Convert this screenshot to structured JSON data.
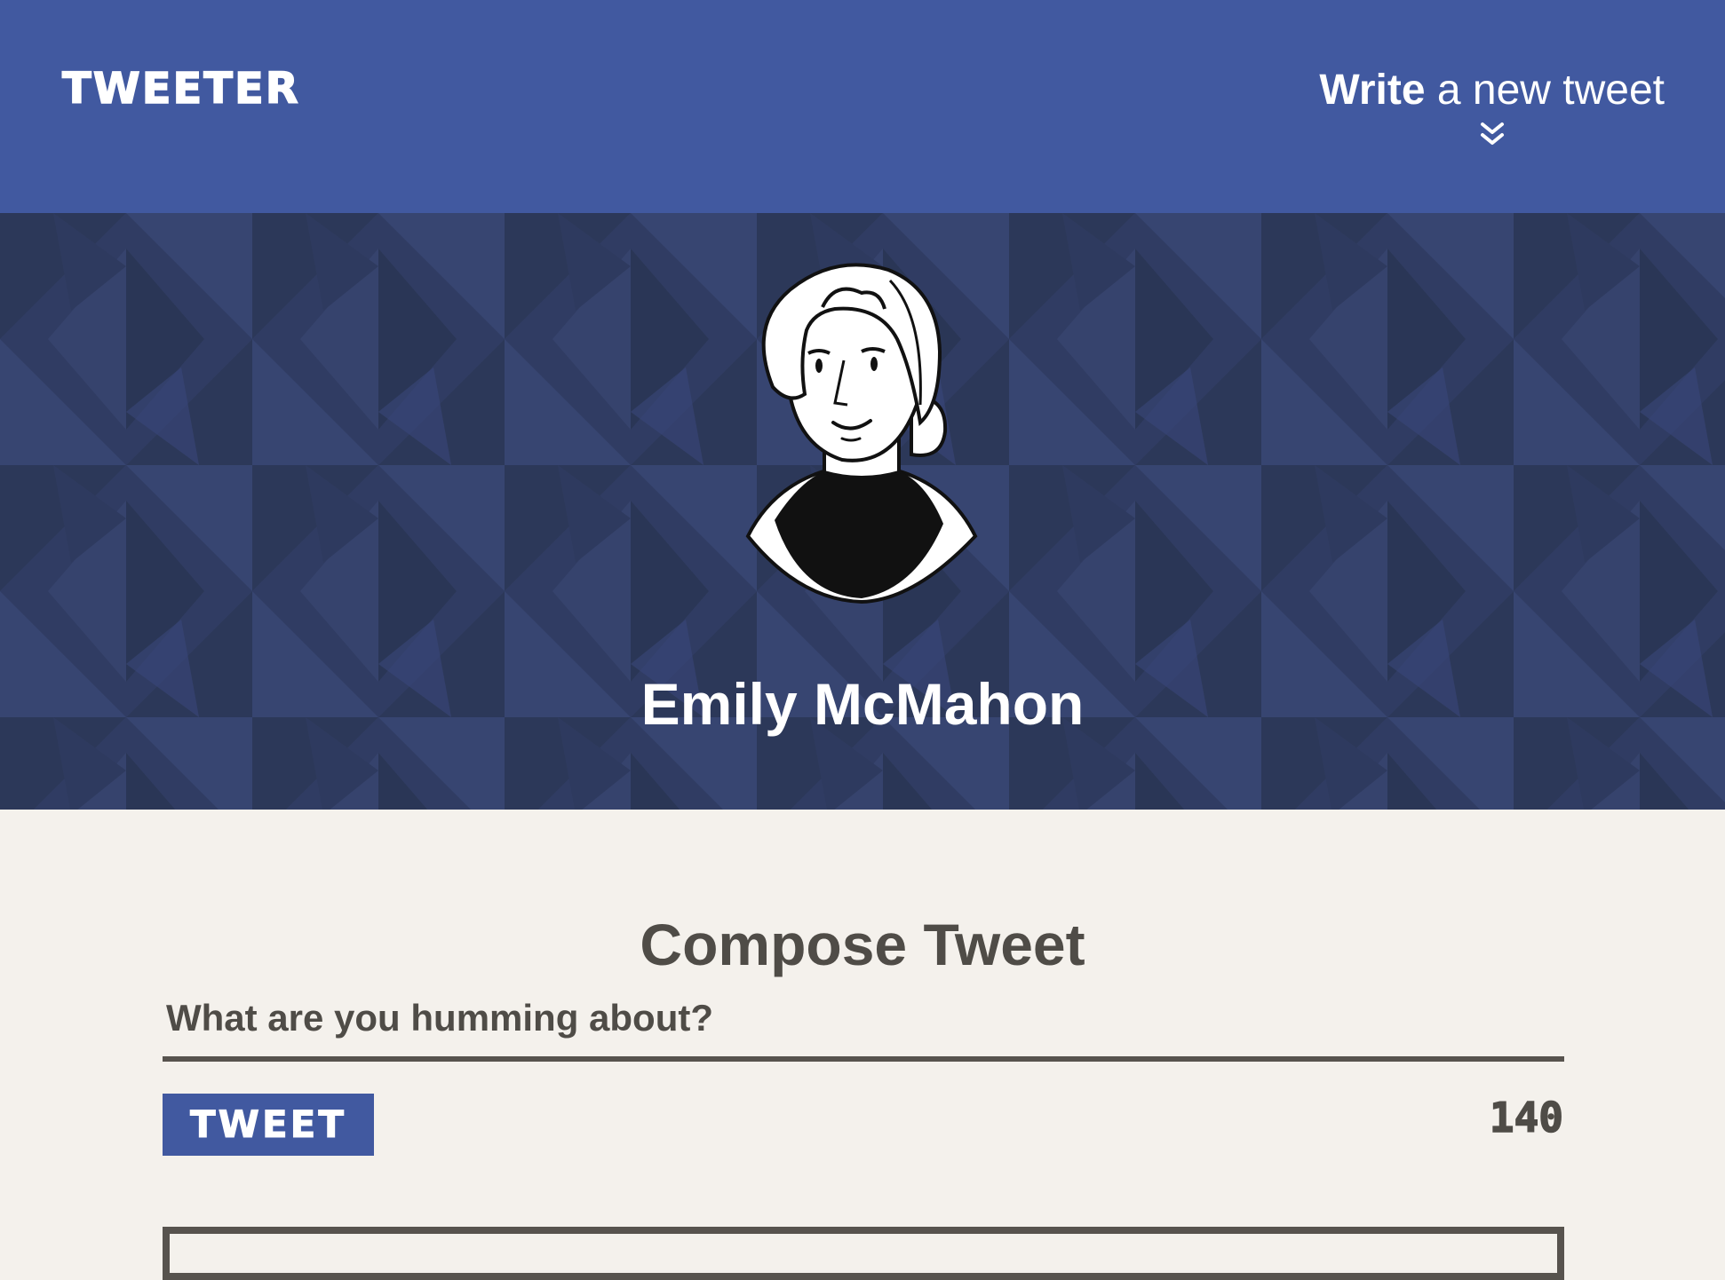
{
  "nav": {
    "brand": "TWEETER",
    "compose_bold": "Write",
    "compose_rest": " a new tweet",
    "chevron_icon": "double-chevron-down"
  },
  "profile": {
    "name": "Emily McMahon",
    "avatar_icon": "woman-avatar-illustration"
  },
  "compose": {
    "title": "Compose Tweet",
    "placeholder": "What are you humming about?",
    "button_label": "TWEET",
    "counter": "140"
  },
  "colors": {
    "brand_blue": "#4159a0",
    "hero_navy": "#323f66",
    "page_bg": "#f4f1ec",
    "text_dark": "#4f4c47"
  }
}
